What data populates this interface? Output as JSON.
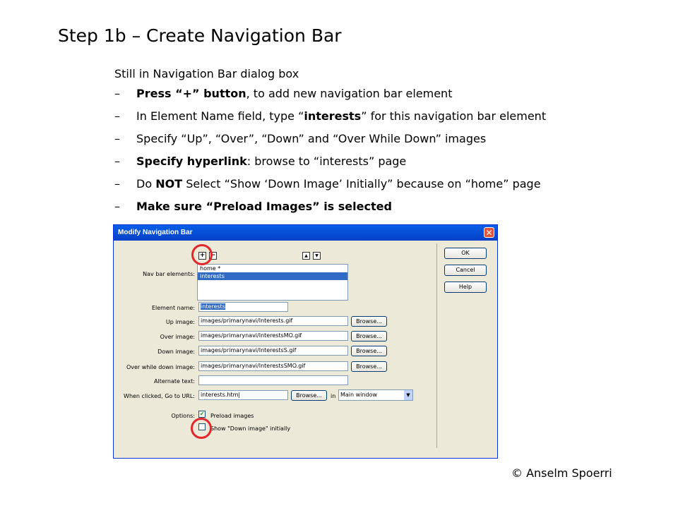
{
  "slide": {
    "title": "Step 1b – Create Navigation Bar",
    "intro": "Still in Navigation Bar dialog box",
    "dash": "–",
    "bullets": [
      {
        "bold_a": "Press “+” button",
        "text_a": ", to add new navigation bar element",
        "bold_b": "",
        "text_b": ""
      },
      {
        "bold_a": "",
        "text_a": "In Element Name field, type “",
        "bold_b": "interests",
        "text_b": "” for this navigation bar element"
      },
      {
        "bold_a": "",
        "text_a": "Specify “Up”, “Over”, “Down” and “Over While Down” images",
        "bold_b": "",
        "text_b": ""
      },
      {
        "bold_a": "Specify hyperlink",
        "text_a": ": browse to “interests” page",
        "bold_b": "",
        "text_b": ""
      },
      {
        "bold_a": "",
        "text_a": "Do ",
        "bold_b": "NOT",
        "text_b": " Select “Show ‘Down Image’ Initially” because on “home” page"
      },
      {
        "bold_a": "Make sure “Preload Images” is selected",
        "text_a": "",
        "bold_b": "",
        "text_b": ""
      }
    ],
    "credit": "© Anselm Spoerri"
  },
  "dialog": {
    "title": "Modify Navigation Bar",
    "close_glyph": "✕",
    "add_glyph": "+",
    "remove_glyph": "−",
    "up_glyph": "▲",
    "down_glyph": "▼",
    "nav_label": "Nav bar elements:",
    "list_items": [
      "home *",
      "interests"
    ],
    "selected_index": 1,
    "element_name_label": "Element name:",
    "element_name_value": "interests",
    "up_label": "Up image:",
    "up_value": "images/primarynavi/Interests.gif",
    "over_label": "Over image:",
    "over_value": "images/primarynavi/InterestsMO.gif",
    "down_label": "Down image:",
    "down_value": "images/primarynavi/InterestsS.gif",
    "overdown_label": "Over while down image:",
    "overdown_value": "images/primarynavi/InterestsSMO.gif",
    "alt_label": "Alternate text:",
    "alt_value": "",
    "url_label": "When clicked, Go to URL:",
    "url_value": "interests.htm|",
    "in_label": "in",
    "target_value": "Main window",
    "select_arrow": "▼",
    "options_label": "Options:",
    "preload_label": "Preload images",
    "preload_checked": true,
    "check_glyph": "✔",
    "show_down_label": "Show \"Down image\" initially",
    "show_down_checked": false,
    "browse_label": "Browse...",
    "ok_label": "OK",
    "cancel_label": "Cancel",
    "help_label": "Help",
    "highlight_color": "#e3262b",
    "titlebar_color": "#0651d8"
  }
}
